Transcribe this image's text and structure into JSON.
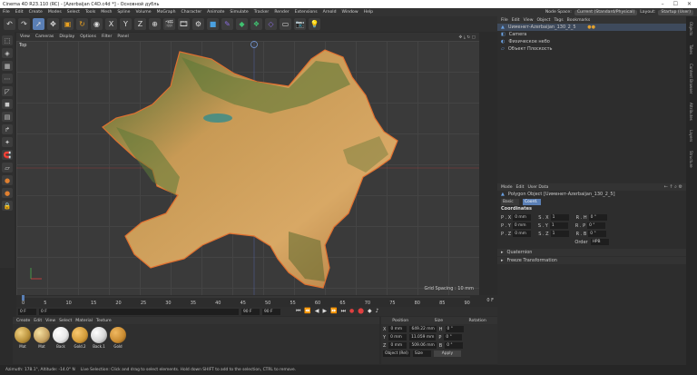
{
  "window": {
    "title": "Cinema 4D R23.110 (RC) - [Azerbaijan C4D.c4d *] - Основной дубль"
  },
  "menu": {
    "items": [
      "File",
      "Edit",
      "Create",
      "Modes",
      "Select",
      "Tools",
      "Mesh",
      "Spline",
      "Volume",
      "MoGraph",
      "Character",
      "Animate",
      "Simulate",
      "Tracker",
      "Render",
      "Extensions",
      "Arnold",
      "Window",
      "Help"
    ],
    "node_space_label": "Node Space:",
    "node_space_value": "Current (Standard/Physical)",
    "layout_label": "Layout:",
    "layout_value": "Startup (User)"
  },
  "viewport": {
    "menu": [
      "View",
      "Cameras",
      "Display",
      "Options",
      "Filter",
      "Panel"
    ],
    "view_name": "Top",
    "grid_spacing": "Grid Spacing : 10 mm"
  },
  "timeline": {
    "ticks": [
      "0",
      "5",
      "10",
      "15",
      "20",
      "25",
      "30",
      "35",
      "40",
      "45",
      "50",
      "55",
      "60",
      "65",
      "70",
      "75",
      "80",
      "85",
      "90"
    ],
    "end": "0 F"
  },
  "transport": {
    "start": "0 F",
    "current": "0 F",
    "end_a": "90 F",
    "end_b": "90 F"
  },
  "object_manager": {
    "menu": [
      "File",
      "Edit",
      "View",
      "Object",
      "Tags",
      "Bookmarks"
    ],
    "objects": [
      {
        "name": "Uименет-Azerbaijan_130_2_5"
      },
      {
        "name": "Camera"
      },
      {
        "name": "Физическое небо"
      },
      {
        "name": "Объект Плоскость"
      }
    ]
  },
  "attribute_manager": {
    "menu": [
      "Mode",
      "Edit",
      "User Data"
    ],
    "object_title": "Polygon Object [Uименет-Azerbaijan_130_2_5]",
    "tabs": [
      "Basic",
      "Coord."
    ],
    "section": "Coordinates",
    "pos": [
      {
        "label": "P . X",
        "val": "0 mm"
      },
      {
        "label": "P . Y",
        "val": "0 mm"
      },
      {
        "label": "P . Z",
        "val": "0 mm"
      }
    ],
    "scale": [
      {
        "label": "S . X",
        "val": "1"
      },
      {
        "label": "S . Y",
        "val": "1"
      },
      {
        "label": "S . Z",
        "val": "1"
      }
    ],
    "rot": [
      {
        "label": "R . H",
        "val": "0 °"
      },
      {
        "label": "R . P",
        "val": "0 °"
      },
      {
        "label": "R . B",
        "val": "0 °"
      }
    ],
    "order_label": "Order",
    "order_value": "HPB",
    "quaternion": "Quaternion",
    "freeze": "Freeze Transformation"
  },
  "material_manager": {
    "menu": [
      "Create",
      "Edit",
      "View",
      "Select",
      "Material",
      "Texture"
    ],
    "materials": [
      {
        "name": "Mat",
        "color": "#b8903a"
      },
      {
        "name": "Mat",
        "color": "#c4a060"
      },
      {
        "name": "Back",
        "color": "#e8e8e8"
      },
      {
        "name": "Gold.2",
        "color": "#d19a38"
      },
      {
        "name": "Back.1",
        "color": "#d8d8d8"
      },
      {
        "name": "Gold",
        "color": "#c88a30"
      }
    ]
  },
  "coord_manager": {
    "headers": [
      "Position",
      "Size",
      "Rotation"
    ],
    "rows": [
      {
        "axis": "X",
        "pos": "0 mm",
        "size": "649.22 mm",
        "rlab": "H",
        "rot": "0 °"
      },
      {
        "axis": "Y",
        "pos": "0 mm",
        "size": "11.059 mm",
        "rlab": "P",
        "rot": "0 °"
      },
      {
        "axis": "Z",
        "pos": "0 mm",
        "size": "509.06 mm",
        "rlab": "B",
        "rot": "0 °"
      }
    ],
    "mode_a": "Object (Rel)",
    "mode_b": "Size",
    "apply": "Apply"
  },
  "status": {
    "azimuth": "Azimuth: 178.1°, Altitude: -14.0°  N",
    "hint": "Live Selection: Click and drag to select elements. Hold down SHIFT to add to the selection, CTRL to remove."
  },
  "side_tabs": [
    "Objects",
    "Takes",
    "Content Browser",
    "Attributes",
    "Layers",
    "Structure"
  ],
  "colors": {
    "accent": "#5a7fb5",
    "map_border": "#e07030",
    "viewport_bg": "#3a3a3a"
  }
}
